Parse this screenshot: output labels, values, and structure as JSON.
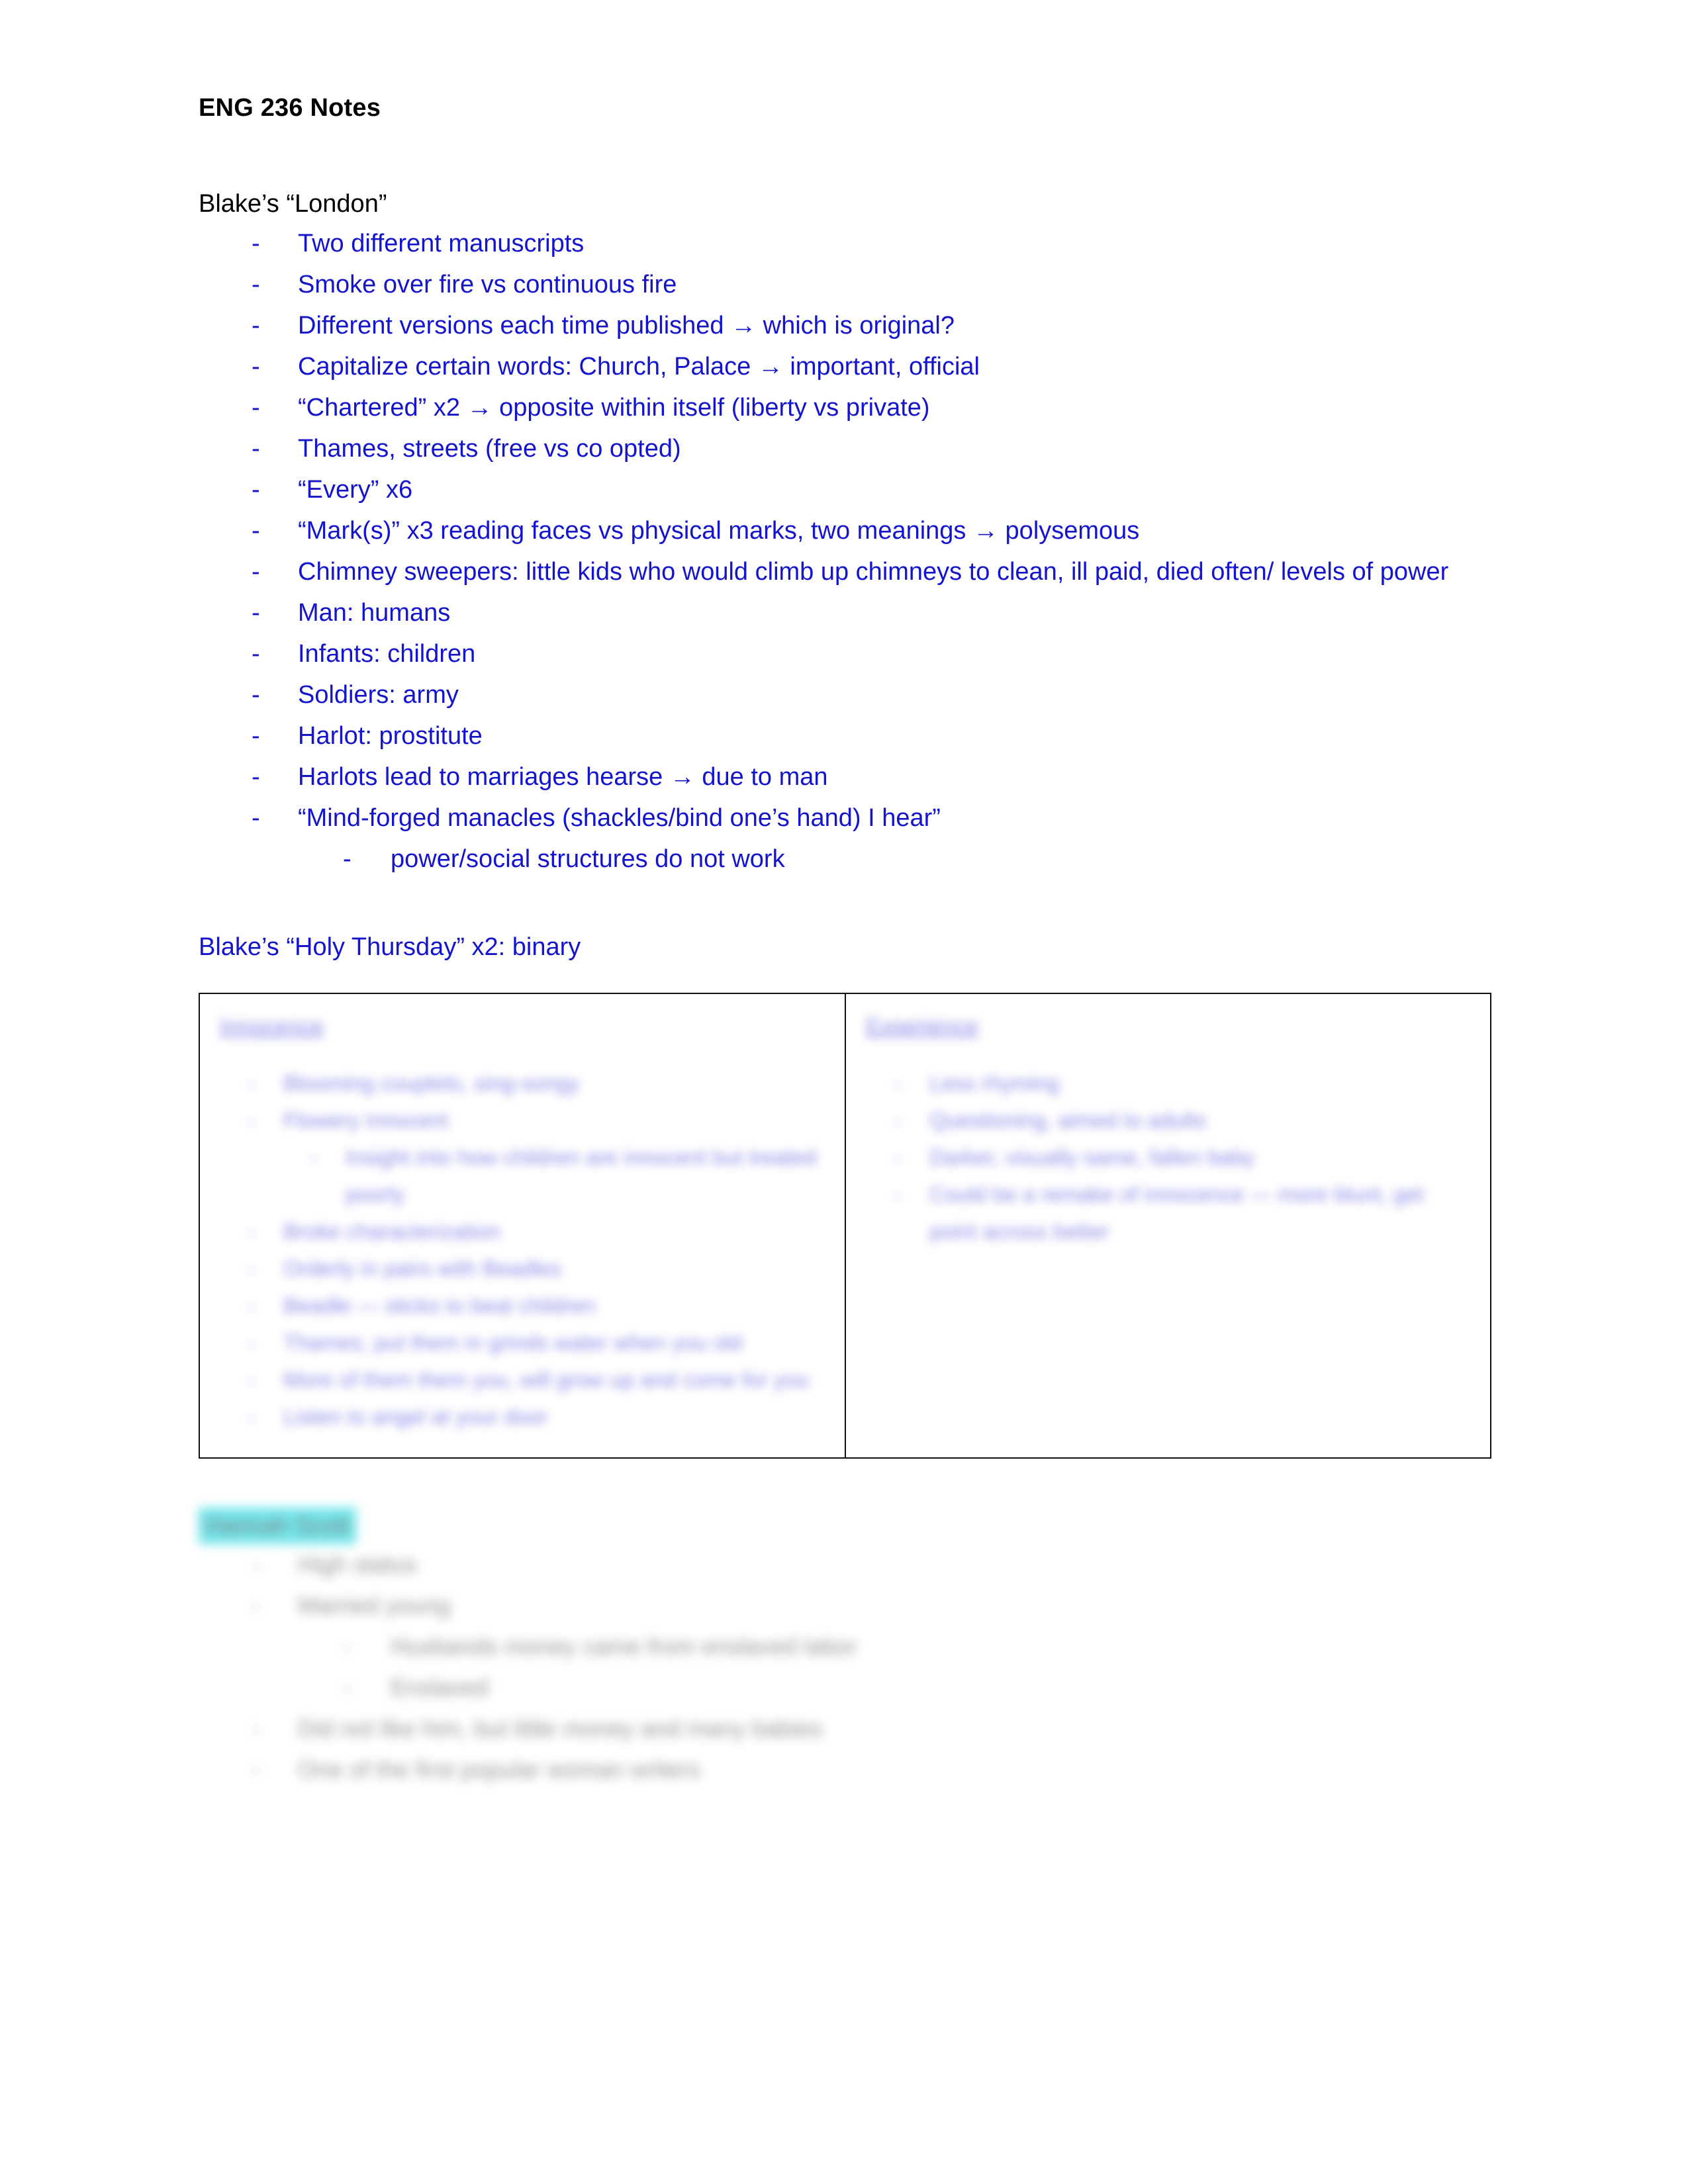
{
  "document": {
    "title": "ENG 236 Notes"
  },
  "sections": {
    "london": {
      "heading": "Blake’s “London”",
      "bullets": [
        "Two different manuscripts",
        "Smoke over fire vs continuous fire",
        "Different versions each time published → which is original?",
        "Capitalize certain words: Church, Palace → important, official",
        "“Chartered” x2 → opposite within itself (liberty vs private)",
        "Thames, streets (free vs co opted)",
        "“Every” x6",
        "“Mark(s)” x3 reading faces vs physical marks, two meanings → polysemous",
        "Chimney sweepers: little kids who would climb up chimneys to clean, ill paid, died often/ levels of power",
        "Man: humans",
        "Infants: children",
        "Soldiers: army",
        "Harlot: prostitute",
        "Harlots lead to marriages hearse → due to man",
        "“Mind-forged manacles (shackles/bind one’s hand) I hear”"
      ],
      "sub_bullets": [
        "power/social structures do not work"
      ]
    },
    "holy_thursday": {
      "heading": "Blake’s “Holy Thursday” x2: binary",
      "table": {
        "columns": [
          {
            "header": "Innocence",
            "items": [
              {
                "text": "Blooming couplets, sing-songy",
                "level": 1
              },
              {
                "text": "Flowery innocent",
                "level": 1
              },
              {
                "text": "Insight into how children are innocent but treated poorly",
                "level": 2
              },
              {
                "text": "Broke characterization",
                "level": 1
              },
              {
                "text": "Orderly in pairs with Beadles",
                "level": 1
              },
              {
                "text": "Beadle — sticks to beat children",
                "level": 1
              },
              {
                "text": "Thames, put them in grinds water when you old",
                "level": 1
              },
              {
                "text": "More of them them you, will grow up and come for you",
                "level": 1
              },
              {
                "text": "Listen to angel at your door",
                "level": 1
              }
            ]
          },
          {
            "header": "Experience",
            "items": [
              {
                "text": "Less rhyming",
                "level": 1
              },
              {
                "text": "Questioning, aimed to adults",
                "level": 1
              },
              {
                "text": "Darker, visually same, fallen baby",
                "level": 1
              },
              {
                "text": "Could be a remake of innocence — more blunt, get point across better",
                "level": 1
              }
            ]
          }
        ]
      }
    },
    "mary_scott": {
      "heading": "Hannah Scott",
      "bullets": [
        {
          "text": "High status",
          "level": 1
        },
        {
          "text": "Married young",
          "level": 1
        },
        {
          "text": "Husbands money came from enslaved labor",
          "level": 2
        },
        {
          "text": "Enslaved",
          "level": 2
        },
        {
          "text": "Did not like him, but little money and many babies",
          "level": 1
        },
        {
          "text": "One of the first popular woman writers",
          "level": 1
        }
      ]
    }
  },
  "colors": {
    "body_text": "#000000",
    "note_blue": "#1414cc",
    "table_blue": "#3f3fd8",
    "highlight_teal": "#00d2da",
    "gray_text": "#3b3b3b",
    "table_border": "#111111"
  }
}
